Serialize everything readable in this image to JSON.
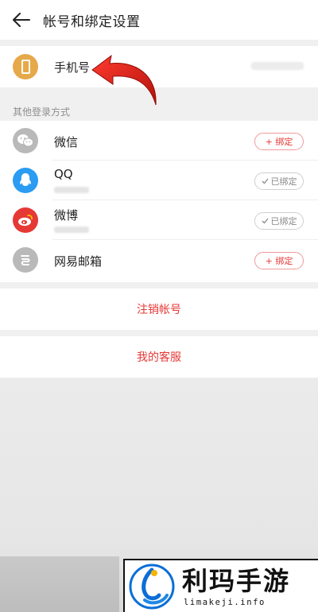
{
  "header": {
    "title": "帐号和绑定设置",
    "back_icon": "arrow-left-icon"
  },
  "phone": {
    "label": "手机号",
    "value": "",
    "icon": "smartphone-icon",
    "icon_color": "#e6a94a"
  },
  "other_logins": {
    "section_title": "其他登录方式",
    "items": [
      {
        "name": "微信",
        "account": "",
        "status": "+ 绑定",
        "icon": "wechat-icon",
        "color": "#b9b9b9"
      },
      {
        "name": "QQ",
        "account": "",
        "status": "已绑定",
        "icon": "qq-penguin-icon",
        "color": "#2b9cf2"
      },
      {
        "name": "微博",
        "account": "",
        "status": "已绑定",
        "icon": "weibo-icon",
        "color": "#e53935"
      },
      {
        "name": "网易邮箱",
        "account": "",
        "status": "+ 绑定",
        "icon": "netease-mail-icon",
        "color": "#b9b9b9"
      }
    ]
  },
  "actions": {
    "cancel_account": "注销帐号",
    "customer_service": "我的客服"
  },
  "watermark": {
    "brand": "利玛手游",
    "url": "limakeji.info"
  },
  "colors": {
    "accent": "#e53935",
    "background": "#f0f0f0"
  }
}
